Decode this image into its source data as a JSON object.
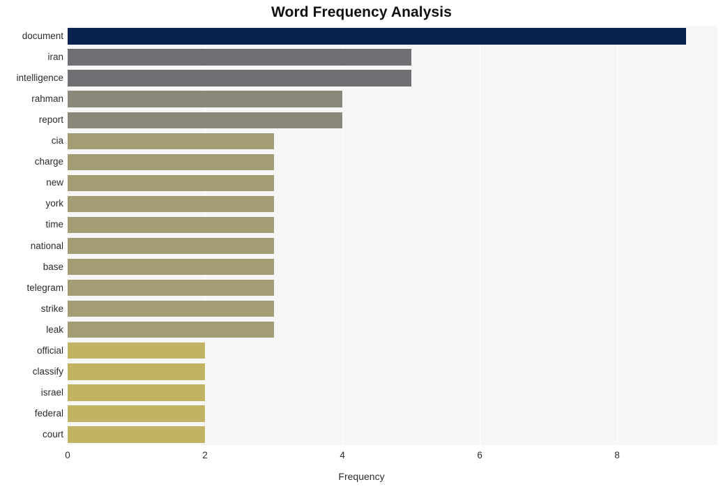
{
  "chart_data": {
    "type": "bar",
    "orientation": "horizontal",
    "title": "Word Frequency Analysis",
    "xlabel": "Frequency",
    "ylabel": "",
    "xlim": [
      0,
      9.46
    ],
    "xticks": [
      0,
      2,
      4,
      6,
      8
    ],
    "xtick_labels": [
      "0",
      "2",
      "4",
      "6",
      "8"
    ],
    "grid": true,
    "grid_axis": "x",
    "legend": null,
    "plot_background": "#f6f6f7",
    "figure_background": "#ffffff",
    "categories": [
      "document",
      "iran",
      "intelligence",
      "rahman",
      "report",
      "cia",
      "charge",
      "new",
      "york",
      "time",
      "national",
      "base",
      "telegram",
      "strike",
      "leak",
      "official",
      "classify",
      "israel",
      "federal",
      "court"
    ],
    "values": [
      9,
      5,
      5,
      4,
      4,
      3,
      3,
      3,
      3,
      3,
      3,
      3,
      3,
      3,
      3,
      2,
      2,
      2,
      2,
      2
    ],
    "bar_colors": [
      "#09224f",
      "#6e7073",
      "#6e7073",
      "#8a8878",
      "#8a8878",
      "#a39c74",
      "#a39c74",
      "#a39c74",
      "#a39c74",
      "#a39c74",
      "#a39c74",
      "#a39c74",
      "#a39c74",
      "#a39c74",
      "#a39c74",
      "#c2b264",
      "#c2b264",
      "#c2b264",
      "#c2b264",
      "#c2b264"
    ]
  }
}
